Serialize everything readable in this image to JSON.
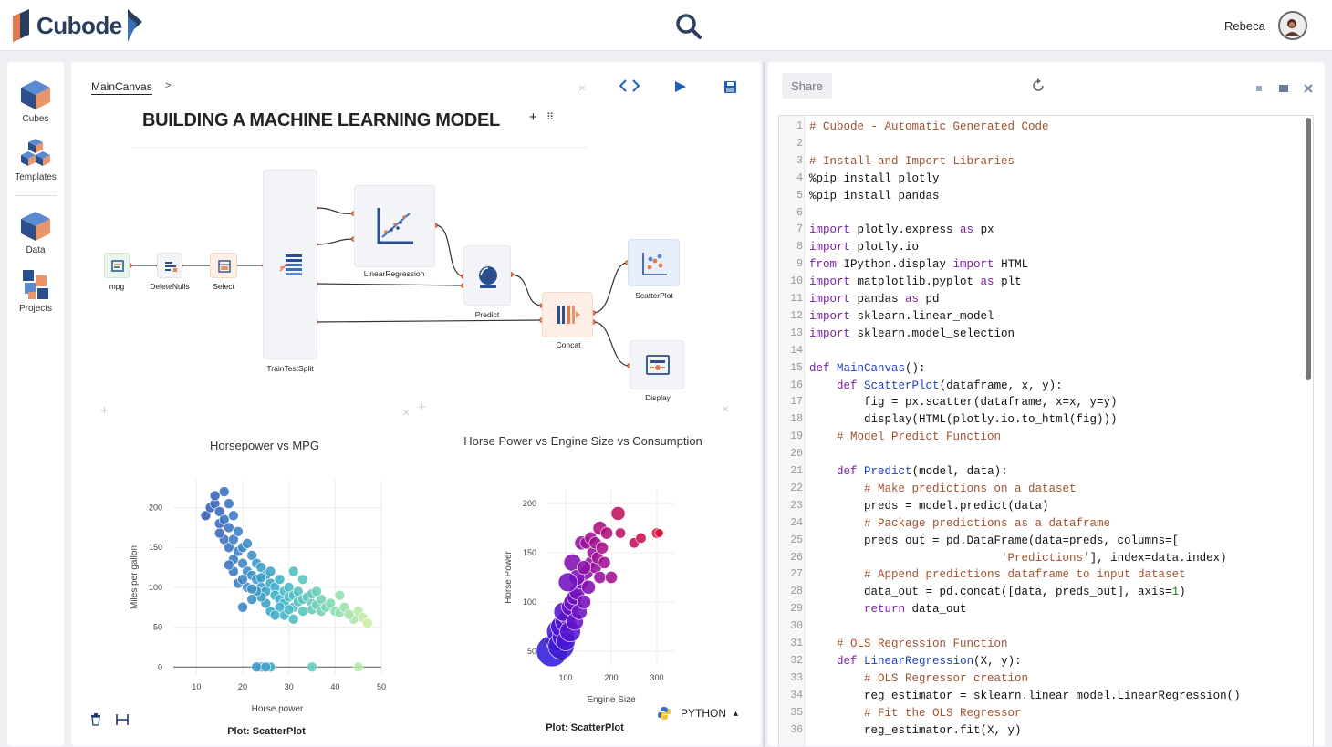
{
  "app": {
    "logo_text": "Cubode",
    "user_name": "Rebeca",
    "search_icon": "search-icon"
  },
  "sidebar": {
    "items": [
      {
        "label": "Cubes",
        "icon": "cube-icon"
      },
      {
        "label": "Templates",
        "icon": "templates-icon"
      },
      {
        "label": "Data",
        "icon": "data-icon"
      },
      {
        "label": "Projects",
        "icon": "projects-icon"
      }
    ]
  },
  "canvas": {
    "breadcrumb": "MainCanvas",
    "breadcrumb_sep": ">",
    "title": "BUILDING A MACHINE LEARNING MODEL",
    "add_symbol": "+",
    "drag_symbol": "⠿",
    "close_symbol": "×",
    "toolbar": {
      "code_icon": "code-icon",
      "run_icon": "play-icon",
      "save_icon": "save-icon"
    },
    "nodes": [
      {
        "id": "mpg",
        "label": "mpg"
      },
      {
        "id": "deletenulls",
        "label": "DeleteNulls"
      },
      {
        "id": "select",
        "label": "Select"
      },
      {
        "id": "traintestsplit",
        "label": "TrainTestSplit"
      },
      {
        "id": "linearregression",
        "label": "LinearRegression"
      },
      {
        "id": "predict",
        "label": "Predict"
      },
      {
        "id": "concat",
        "label": "Concat"
      },
      {
        "id": "scatterplot",
        "label": "ScatterPlot"
      },
      {
        "id": "display",
        "label": "Display"
      }
    ],
    "plot_captions": [
      "Plot: ScatterPlot",
      "Plot: ScatterPlot"
    ],
    "language": "PYTHON",
    "language_caret": "▴"
  },
  "chart_data": [
    {
      "type": "scatter",
      "title": "Horsepower vs MPG",
      "xlabel": "Horse power",
      "ylabel": "Miles per gallon",
      "xlim": [
        5,
        50
      ],
      "ylim": [
        -10,
        235
      ],
      "xticks": [
        10,
        20,
        30,
        40,
        50
      ],
      "yticks": [
        0,
        50,
        100,
        150,
        200
      ],
      "grid": true,
      "color_scale": [
        "#2a3a8c",
        "#3a6fc0",
        "#3ab0c8",
        "#7cd8b0",
        "#e8f5a0"
      ],
      "points": [
        [
          12,
          190
        ],
        [
          13,
          200
        ],
        [
          14,
          205
        ],
        [
          14,
          215
        ],
        [
          15,
          195
        ],
        [
          15,
          180
        ],
        [
          16,
          220
        ],
        [
          16,
          185
        ],
        [
          17,
          205
        ],
        [
          17,
          175
        ],
        [
          16,
          160
        ],
        [
          17,
          150
        ],
        [
          18,
          160
        ],
        [
          18,
          190
        ],
        [
          19,
          170
        ],
        [
          19,
          145
        ],
        [
          20,
          150
        ],
        [
          20,
          130
        ],
        [
          21,
          155
        ],
        [
          21,
          120
        ],
        [
          22,
          140
        ],
        [
          22,
          115
        ],
        [
          23,
          130
        ],
        [
          23,
          110
        ],
        [
          24,
          125
        ],
        [
          24,
          100
        ],
        [
          25,
          115
        ],
        [
          25,
          95
        ],
        [
          26,
          120
        ],
        [
          26,
          105
        ],
        [
          27,
          100
        ],
        [
          27,
          90
        ],
        [
          28,
          110
        ],
        [
          28,
          85
        ],
        [
          29,
          95
        ],
        [
          29,
          80
        ],
        [
          30,
          100
        ],
        [
          30,
          88
        ],
        [
          31,
          90
        ],
        [
          31,
          75
        ],
        [
          32,
          95
        ],
        [
          32,
          82
        ],
        [
          33,
          85
        ],
        [
          33,
          70
        ],
        [
          34,
          88
        ],
        [
          35,
          80
        ],
        [
          35,
          72
        ],
        [
          36,
          78
        ],
        [
          37,
          85
        ],
        [
          37,
          70
        ],
        [
          38,
          75
        ],
        [
          39,
          80
        ],
        [
          40,
          70
        ],
        [
          41,
          68
        ],
        [
          42,
          75
        ],
        [
          44,
          60
        ],
        [
          45,
          70
        ],
        [
          46,
          62
        ],
        [
          28,
          75
        ],
        [
          26,
          70
        ],
        [
          25,
          80
        ],
        [
          24,
          88
        ],
        [
          20,
          75
        ],
        [
          18,
          120
        ],
        [
          19,
          105
        ],
        [
          21,
          100
        ],
        [
          23,
          95
        ],
        [
          22,
          85
        ],
        [
          33,
          110
        ],
        [
          35,
          92
        ],
        [
          29,
          65
        ],
        [
          31,
          60
        ],
        [
          27,
          65
        ],
        [
          18,
          135
        ],
        [
          17,
          128
        ],
        [
          20,
          110
        ],
        [
          15,
          168
        ],
        [
          22,
          98
        ],
        [
          24,
          112
        ],
        [
          30,
          72
        ],
        [
          31,
          120
        ],
        [
          36,
          95
        ],
        [
          41,
          90
        ],
        [
          43,
          66
        ],
        [
          47,
          55
        ],
        [
          26,
          0
        ],
        [
          24,
          0
        ],
        [
          23,
          0
        ],
        [
          25,
          0
        ],
        [
          35,
          0
        ],
        [
          45,
          0
        ]
      ]
    },
    {
      "type": "scatter",
      "title": "Horse Power vs Engine Size vs Consumption",
      "xlabel": "Engine Size",
      "ylabel": "Horse Power",
      "xlim": [
        60,
        340
      ],
      "ylim": [
        35,
        215
      ],
      "xticks": [
        100,
        200,
        300
      ],
      "yticks": [
        50,
        100,
        150,
        200
      ],
      "grid": true,
      "color_scale": [
        "#2020e0",
        "#6a10c8",
        "#a01090",
        "#d0104a",
        "#e81818"
      ],
      "points": [
        [
          70,
          50,
          18
        ],
        [
          80,
          60,
          12
        ],
        [
          85,
          70,
          14
        ],
        [
          90,
          55,
          15
        ],
        [
          95,
          65,
          13
        ],
        [
          90,
          75,
          12
        ],
        [
          100,
          80,
          12
        ],
        [
          100,
          60,
          11
        ],
        [
          105,
          85,
          10
        ],
        [
          95,
          90,
          11
        ],
        [
          110,
          95,
          10
        ],
        [
          110,
          70,
          12
        ],
        [
          115,
          100,
          10
        ],
        [
          120,
          105,
          9
        ],
        [
          120,
          80,
          10
        ],
        [
          125,
          110,
          9
        ],
        [
          130,
          90,
          9
        ],
        [
          135,
          120,
          8
        ],
        [
          140,
          100,
          8
        ],
        [
          145,
          130,
          8
        ],
        [
          150,
          115,
          8
        ],
        [
          155,
          140,
          7
        ],
        [
          160,
          150,
          7
        ],
        [
          165,
          135,
          7
        ],
        [
          170,
          145,
          7
        ],
        [
          175,
          125,
          7
        ],
        [
          135,
          160,
          8
        ],
        [
          145,
          160,
          7
        ],
        [
          155,
          165,
          7
        ],
        [
          165,
          160,
          7
        ],
        [
          180,
          155,
          7
        ],
        [
          185,
          140,
          7
        ],
        [
          200,
          125,
          7
        ],
        [
          175,
          175,
          8
        ],
        [
          215,
          190,
          8
        ],
        [
          220,
          170,
          6
        ],
        [
          250,
          160,
          6
        ],
        [
          265,
          165,
          6
        ],
        [
          300,
          170,
          6
        ],
        [
          305,
          170,
          5
        ],
        [
          115,
          140,
          10
        ],
        [
          125,
          125,
          9
        ],
        [
          105,
          120,
          11
        ],
        [
          140,
          135,
          8
        ],
        [
          190,
          170,
          7
        ]
      ]
    }
  ],
  "code_panel": {
    "share_label": "Share",
    "refresh_icon": "refresh-icon",
    "lines": [
      {
        "n": "1",
        "t": "# Cubode - Automatic Generated Code",
        "k": "com"
      },
      {
        "n": "2",
        "t": "",
        "k": "plain"
      },
      {
        "n": "3",
        "t": "# Install and Import Libraries",
        "k": "com"
      },
      {
        "n": "4",
        "t": "%pip install plotly",
        "k": "plain"
      },
      {
        "n": "5",
        "t": "%pip install pandas",
        "k": "plain"
      },
      {
        "n": "6",
        "t": "",
        "k": "plain"
      },
      {
        "n": "7",
        "t": "import plotly.express as px",
        "k": "imp"
      },
      {
        "n": "8",
        "t": "import plotly.io",
        "k": "imp"
      },
      {
        "n": "9",
        "t": "from IPython.display import HTML",
        "k": "from"
      },
      {
        "n": "10",
        "t": "import matplotlib.pyplot as plt",
        "k": "imp"
      },
      {
        "n": "11",
        "t": "import pandas as pd",
        "k": "imp"
      },
      {
        "n": "12",
        "t": "import sklearn.linear_model",
        "k": "imp"
      },
      {
        "n": "13",
        "t": "import sklearn.model_selection",
        "k": "imp"
      },
      {
        "n": "14",
        "t": "",
        "k": "plain"
      },
      {
        "n": "15",
        "t": "def MainCanvas():",
        "k": "def"
      },
      {
        "n": "16",
        "t": "    def ScatterPlot(dataframe, x, y):",
        "k": "def"
      },
      {
        "n": "17",
        "t": "        fig = px.scatter(dataframe, x=x, y=y)",
        "k": "plain"
      },
      {
        "n": "18",
        "t": "        display(HTML(plotly.io.to_html(fig)))",
        "k": "plain"
      },
      {
        "n": "19",
        "t": "    # Model Predict Function",
        "k": "com"
      },
      {
        "n": "20",
        "t": "",
        "k": "plain"
      },
      {
        "n": "21",
        "t": "    def Predict(model, data):",
        "k": "def"
      },
      {
        "n": "22",
        "t": "        # Make predictions on a dataset",
        "k": "com"
      },
      {
        "n": "23",
        "t": "        preds = model.predict(data)",
        "k": "plain"
      },
      {
        "n": "24",
        "t": "        # Package predictions as a dataframe",
        "k": "com"
      },
      {
        "n": "25",
        "t": "        preds_out = pd.DataFrame(data=preds, columns=[",
        "k": "plain"
      },
      {
        "n": "26",
        "t": "                            'Predictions'], index=data.index)",
        "k": "str"
      },
      {
        "n": "27",
        "t": "        # Append predictions dataframe to input dataset",
        "k": "com"
      },
      {
        "n": "28",
        "t": "        data_out = pd.concat([data, preds_out], axis=1)",
        "k": "num"
      },
      {
        "n": "29",
        "t": "        return data_out",
        "k": "ret"
      },
      {
        "n": "30",
        "t": "",
        "k": "plain"
      },
      {
        "n": "31",
        "t": "    # OLS Regression Function",
        "k": "com"
      },
      {
        "n": "32",
        "t": "    def LinearRegression(X, y):",
        "k": "def"
      },
      {
        "n": "33",
        "t": "        # OLS Regressor creation",
        "k": "com"
      },
      {
        "n": "34",
        "t": "        reg_estimator = sklearn.linear_model.LinearRegression()",
        "k": "plain"
      },
      {
        "n": "35",
        "t": "        # Fit the OLS Regressor",
        "k": "com"
      },
      {
        "n": "36",
        "t": "        reg_estimator.fit(X, y)",
        "k": "plain"
      }
    ]
  }
}
